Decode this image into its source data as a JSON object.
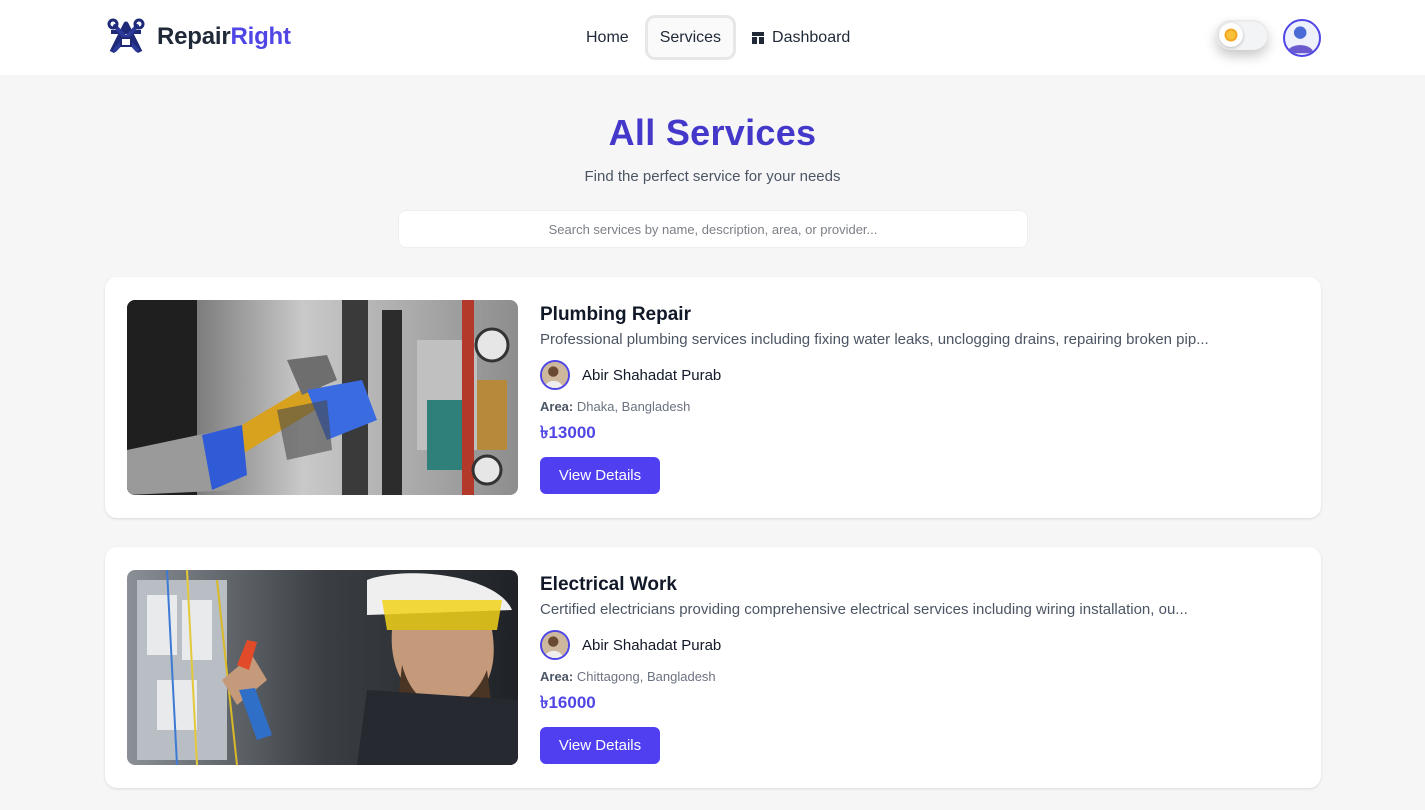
{
  "brand": {
    "name_part1": "Repair",
    "name_part2": "Right",
    "accent_color": "#4f46e5"
  },
  "nav": {
    "links": [
      {
        "label": "Home",
        "active": false
      },
      {
        "label": "Services",
        "active": true
      },
      {
        "label": "Dashboard",
        "active": false,
        "icon": "dashboard-icon"
      }
    ],
    "theme_toggle_icon": "sun-icon",
    "avatar_icon": "user-avatar-icon"
  },
  "header": {
    "title": "All Services",
    "subtitle": "Find the perfect service for your needs",
    "title_color": "#4338ca"
  },
  "search": {
    "placeholder": "Search services by name, description, area, or provider...",
    "value": ""
  },
  "services": [
    {
      "title": "Plumbing Repair",
      "description": "Professional plumbing services including fixing water leaks, unclogging drains, repairing broken pip...",
      "provider": "Abir Shahadat Purab",
      "area_label": "Area:",
      "area": "Dhaka, Bangladesh",
      "price": "৳13000",
      "button_label": "View Details",
      "image": "plumber-wrench-photo"
    },
    {
      "title": "Electrical Work",
      "description": "Certified electricians providing comprehensive electrical services including wiring installation, ou...",
      "provider": "Abir Shahadat Purab",
      "area_label": "Area:",
      "area": "Chittagong, Bangladesh",
      "price": "৳16000",
      "button_label": "View Details",
      "image": "electrician-photo"
    }
  ],
  "colors": {
    "primary_button": "#4f3ff0",
    "price": "#4f46e5",
    "background": "#f6f6f7"
  }
}
